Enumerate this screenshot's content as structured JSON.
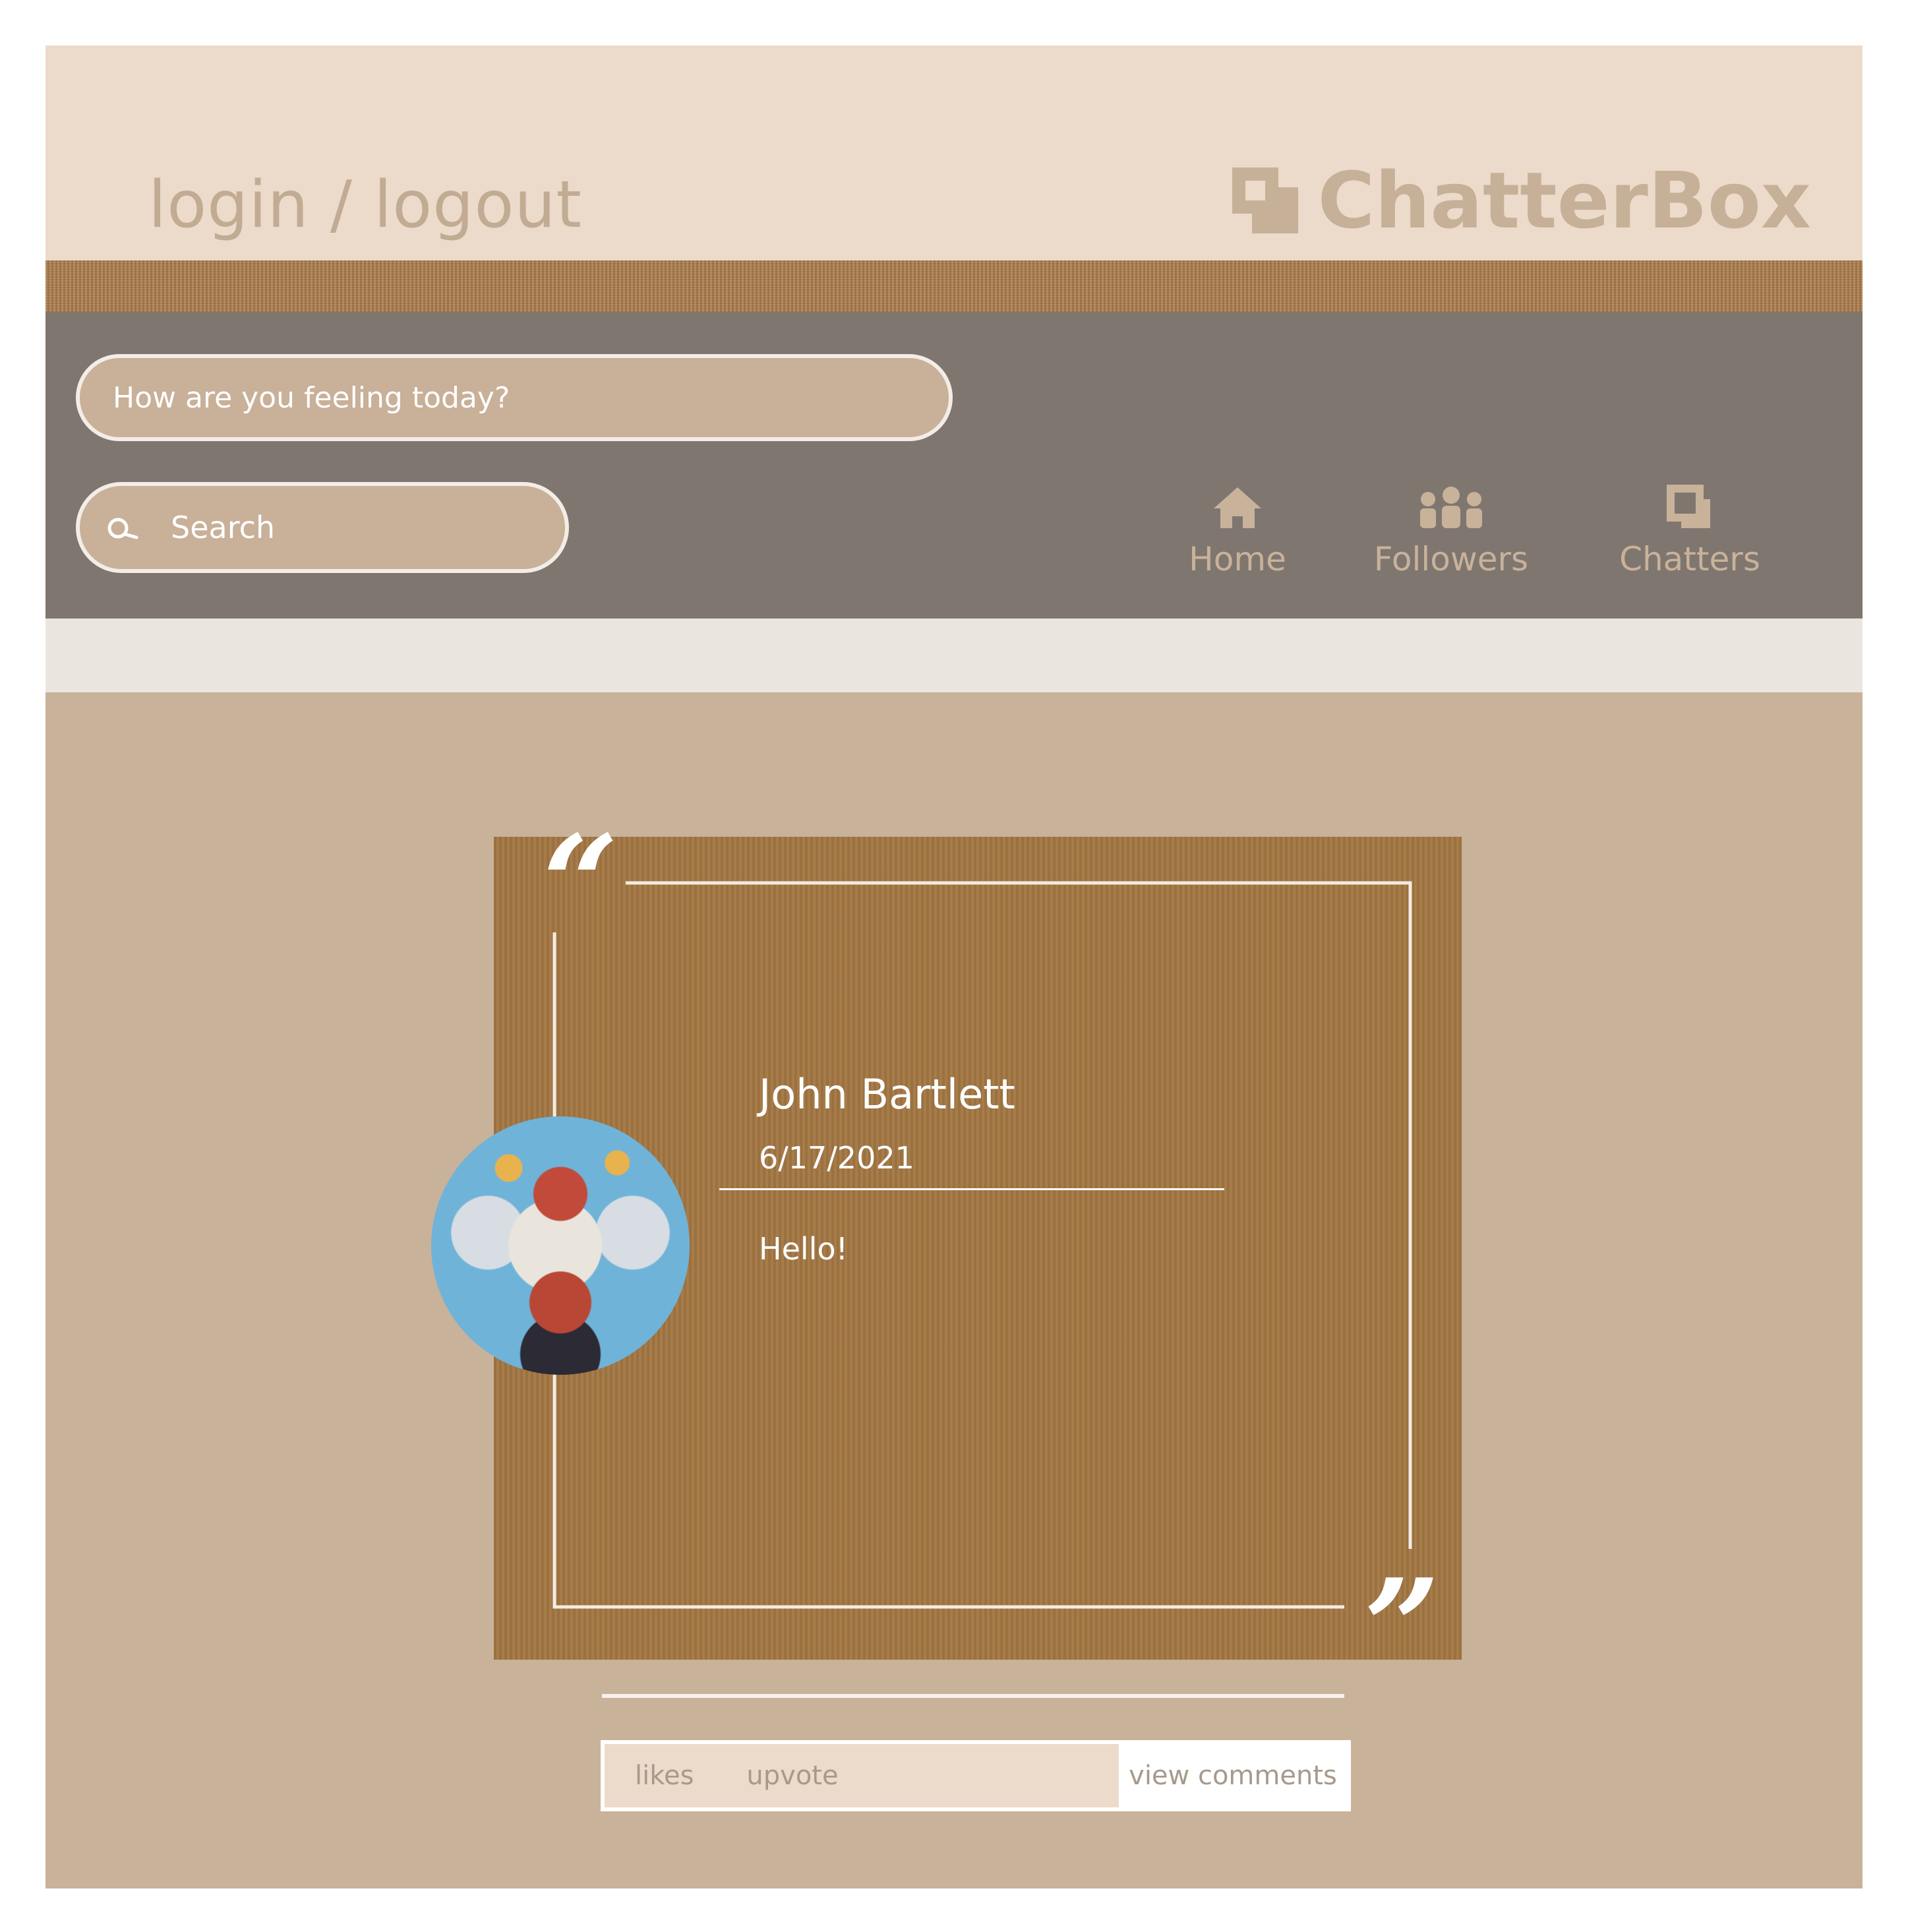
{
  "header": {
    "login_label": "login / logout",
    "brand_name": "ChatterBox",
    "brand_icon": "overlapping-squares-icon"
  },
  "composer": {
    "status_placeholder": "How are you feeling today?"
  },
  "search": {
    "placeholder": "Search",
    "icon": "search-icon"
  },
  "nav": {
    "items": [
      {
        "label": "Home",
        "icon": "house-icon"
      },
      {
        "label": "Followers",
        "icon": "people-icon"
      },
      {
        "label": "Chatters",
        "icon": "overlapping-squares-icon"
      }
    ]
  },
  "post": {
    "author": "John Bartlett",
    "date": "6/17/2021",
    "body": "Hello!",
    "quote_open": "“",
    "quote_close": "”"
  },
  "actions": {
    "likes_label": "likes",
    "upvote_label": "upvote",
    "view_comments_label": "view comments"
  },
  "colors": {
    "header_bg": "#ecdacb",
    "nav_bg": "#7f7670",
    "page_bg": "#c9b29a",
    "card_bg": "#a37743",
    "accent_text": "#c7b098"
  }
}
